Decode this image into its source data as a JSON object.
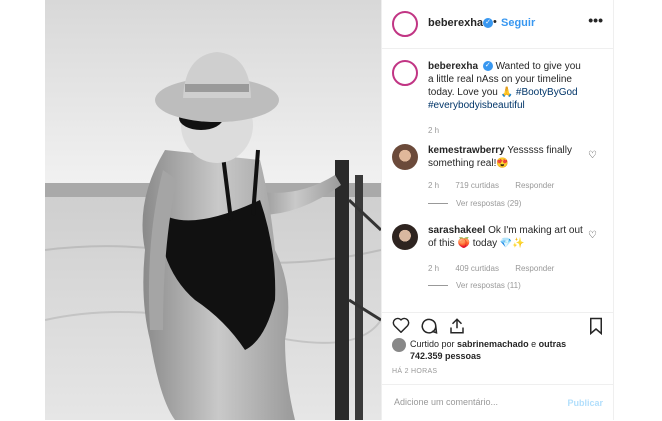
{
  "post": {
    "username": "beberexha",
    "follow_label": "Seguir",
    "separator": "•",
    "more_icon": "more-options-icon",
    "caption": {
      "username": "beberexha",
      "text": "Wanted to give you a little real nAss on your timeline today. Love you",
      "hashtag1": "#BootyByGod",
      "hashtag2": "#everybodyisbeautiful",
      "time": "2 h"
    },
    "comments": [
      {
        "username": "kemestrawberry",
        "text": "Yesssss finally something real!😍",
        "time": "2 h",
        "likes": "719 curtidas",
        "reply_label": "Responder",
        "view_replies": "Ver respostas (29)"
      },
      {
        "username": "sarashakeel",
        "text": "Ok I'm making art out of this 🍑 today 💎✨",
        "time": "2 h",
        "likes": "409 curtidas",
        "reply_label": "Responder",
        "view_replies": "Ver respostas (11)"
      }
    ],
    "likes_line": {
      "prefix": "Curtido por",
      "user": "sabrinemachado",
      "mid": "e",
      "others": "outras 742.359 pessoas"
    },
    "timestamp": "HÁ 2 HORAS",
    "comment_placeholder": "Adicione um comentário...",
    "publish_label": "Publicar",
    "colors": {
      "accent": "#3897f0",
      "publish_disabled": "#b2dffc",
      "hashtag": "#003569"
    }
  }
}
